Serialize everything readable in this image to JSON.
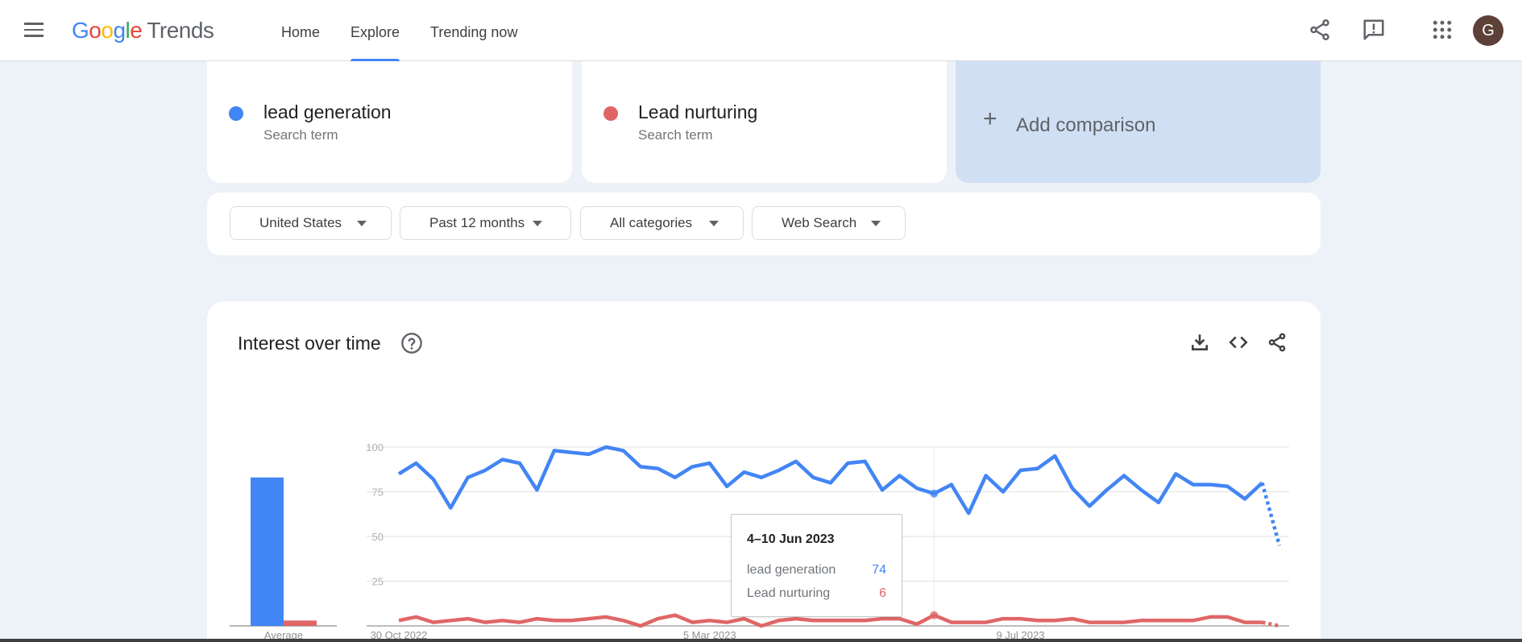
{
  "header": {
    "menu_icon": "hamburger-menu-icon",
    "logo": {
      "google": [
        "G",
        "o",
        "o",
        "g",
        "l",
        "e"
      ],
      "product": "Trends"
    },
    "nav": [
      {
        "label": "Home",
        "active": false
      },
      {
        "label": "Explore",
        "active": true
      },
      {
        "label": "Trending now",
        "active": false
      }
    ],
    "icons": [
      "share-icon",
      "feedback-icon",
      "apps-grid-icon"
    ],
    "avatar_letter": "G",
    "avatar_color": "#5d4037"
  },
  "terms": [
    {
      "name": "lead generation",
      "subtitle": "Search term",
      "color": "#4285f4"
    },
    {
      "name": "Lead nurturing",
      "subtitle": "Search term",
      "color": "#e06666"
    }
  ],
  "add_comparison": {
    "icon": "+",
    "label": "Add comparison"
  },
  "filters": [
    {
      "label": "United States"
    },
    {
      "label": "Past 12 months"
    },
    {
      "label": "All categories"
    },
    {
      "label": "Web Search"
    }
  ],
  "interest_over_time": {
    "title": "Interest over time",
    "actions": [
      "download-icon",
      "embed-code-icon",
      "share-icon"
    ]
  },
  "tooltip": {
    "date": "4–10 Jun 2023",
    "rows": [
      {
        "label": "lead generation",
        "value": "74",
        "color": "#4285f4"
      },
      {
        "label": "Lead nurturing",
        "value": "6",
        "color": "#e06666"
      }
    ]
  },
  "chart_data": {
    "type": "line",
    "title": "Interest over time",
    "xlabel": "",
    "ylabel": "",
    "ylim": [
      0,
      100
    ],
    "yticks": [
      25,
      50,
      75,
      100
    ],
    "grid": true,
    "x_tick_labels": [
      {
        "label": "30 Oct 2022",
        "index": 0
      },
      {
        "label": "5 Mar 2023",
        "index": 18
      },
      {
        "label": "9 Jul 2023",
        "index": 36
      }
    ],
    "x_start": "30 Oct 2022",
    "x_interval": "weekly",
    "hover_index": 31,
    "partial_last_point": true,
    "series": [
      {
        "name": "lead generation",
        "color": "#4285f4",
        "average": 83,
        "values": [
          85,
          91,
          82,
          66,
          83,
          87,
          93,
          91,
          76,
          98,
          97,
          96,
          100,
          98,
          89,
          88,
          83,
          89,
          91,
          78,
          86,
          83,
          87,
          92,
          83,
          80,
          91,
          92,
          76,
          84,
          77,
          74,
          79,
          63,
          84,
          75,
          87,
          88,
          95,
          77,
          67,
          76,
          84,
          76,
          69,
          85,
          79,
          79,
          78,
          71,
          80,
          45
        ]
      },
      {
        "name": "Lead nurturing",
        "color": "#e06666",
        "average": 3,
        "values": [
          3,
          5,
          2,
          3,
          4,
          2,
          3,
          2,
          4,
          3,
          3,
          4,
          5,
          3,
          0,
          4,
          6,
          2,
          3,
          2,
          4,
          0,
          3,
          4,
          3,
          3,
          3,
          3,
          4,
          4,
          1,
          6,
          2,
          2,
          2,
          4,
          4,
          3,
          3,
          4,
          2,
          2,
          2,
          3,
          3,
          3,
          3,
          5,
          5,
          2,
          2,
          0
        ]
      }
    ],
    "average_label": "Average"
  }
}
